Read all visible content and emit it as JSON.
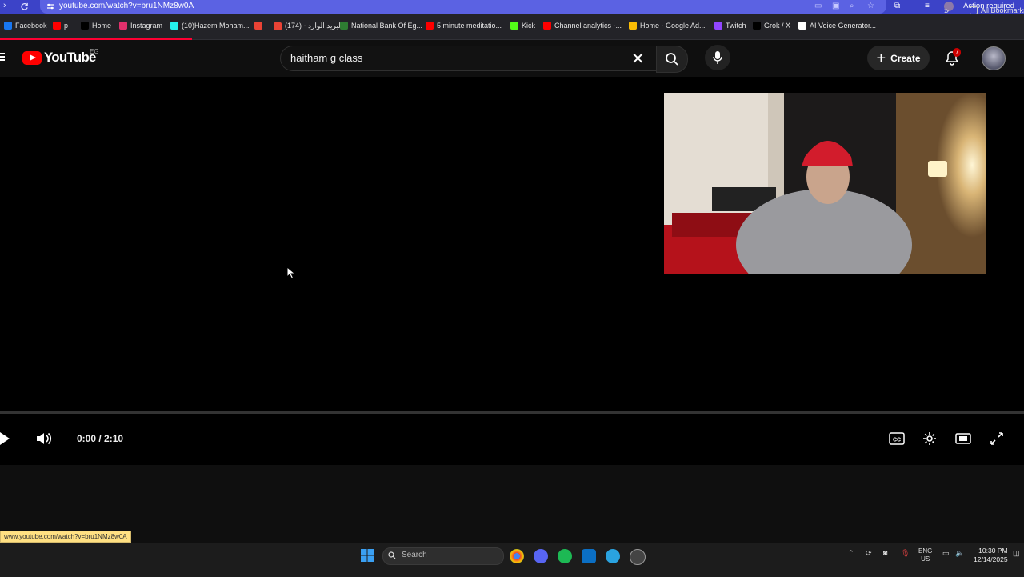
{
  "browser": {
    "url": "youtube.com/watch?v=bru1NMz8w0A",
    "action_required": "Action required",
    "bookmarks": [
      {
        "label": "Facebook",
        "color": "#1877f2"
      },
      {
        "label": "p",
        "color": "#ff0000"
      },
      {
        "label": "Home",
        "color": "#000000"
      },
      {
        "label": "Instagram",
        "color": "#e1306c"
      },
      {
        "label": "(10)Hazem Moham...",
        "color": "#25f4ee"
      },
      {
        "label": "",
        "color": "#ea4335"
      },
      {
        "label": "(174) - البريد الوارد",
        "color": "#ea4335"
      },
      {
        "label": "National Bank Of Eg...",
        "color": "#2e7d32"
      },
      {
        "label": "5 minute meditatio...",
        "color": "#ff0000"
      },
      {
        "label": "Kick",
        "color": "#53fc18"
      },
      {
        "label": "Channel analytics -...",
        "color": "#ff0000"
      },
      {
        "label": "Home - Google Ad...",
        "color": "#fbbc04"
      },
      {
        "label": "Twitch",
        "color": "#9146ff"
      },
      {
        "label": "Grok / X",
        "color": "#000000"
      },
      {
        "label": "AI Voice Generator...",
        "color": "#ffffff"
      }
    ],
    "all_bookmarks": "All Bookmarks",
    "status_url": "www.youtube.com/watch?v=bru1NMz8w0A"
  },
  "youtube": {
    "logo_text": "YouTube",
    "country_code": "EG",
    "search_value": "haitham g class",
    "create_label": "Create",
    "notification_count": "7",
    "brand_color": "#ff0000"
  },
  "player": {
    "time": "0:00 / 2:10",
    "progress": 0
  },
  "taskbar": {
    "search_placeholder": "Search",
    "lang_line1": "ENG",
    "lang_line2": "US",
    "time": "10:30 PM",
    "date": "12/14/2025"
  }
}
